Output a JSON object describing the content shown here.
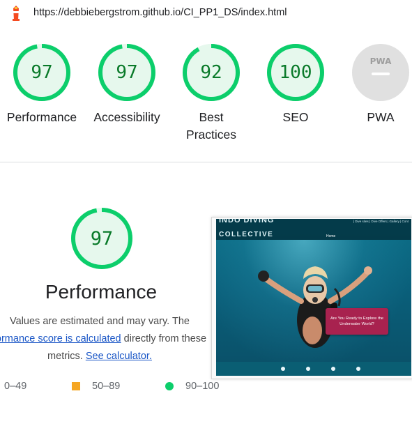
{
  "url_bar": {
    "url": "https://debbiebergstrom.github.io/CI_PP1_DS/index.html",
    "icon": "lighthouse-icon"
  },
  "gauges": [
    {
      "label": "Performance",
      "value": "97",
      "score": 0.97
    },
    {
      "label": "Accessibility",
      "value": "97",
      "score": 0.97
    },
    {
      "label_line1": "Best",
      "label_line2": "Practices",
      "value": "92",
      "score": 0.92
    },
    {
      "label": "SEO",
      "value": "100",
      "score": 1.0
    },
    {
      "label": "PWA",
      "badge": "PWA"
    }
  ],
  "performance_section": {
    "score": "97",
    "score_fraction": 0.97,
    "title": "Performance",
    "desc_line1": "Values are estimated and may vary. The",
    "desc_link1": "formance score is calculated",
    "desc_mid": " directly from these",
    "desc_line3_prefix": "metrics. ",
    "desc_link2": "See calculator."
  },
  "legend": [
    {
      "range": "0–49"
    },
    {
      "range": "50–89",
      "color": "#f5a623"
    },
    {
      "range": "90–100",
      "color": "#0cce6b"
    }
  ],
  "screenshot": {
    "brand_line1": "INDO DIVING",
    "brand_line2": "COLLECTIVE",
    "nav_links": "| Dive sites | Dive Offers | Gallery | Cont",
    "home": "Home",
    "cta": "Are You Ready to Explore the Underwater World?",
    "footer_icons": [
      "facebook-icon",
      "twitter-icon",
      "youtube-icon",
      "instagram-icon"
    ]
  },
  "colors": {
    "pass_green": "#0cce6b",
    "pass_text": "#0a7a2a",
    "pass_fill": "#e6f8ed",
    "average_orange": "#f5a623",
    "link_blue": "#1a56c6",
    "pwa_gray": "#e0e0e0"
  }
}
